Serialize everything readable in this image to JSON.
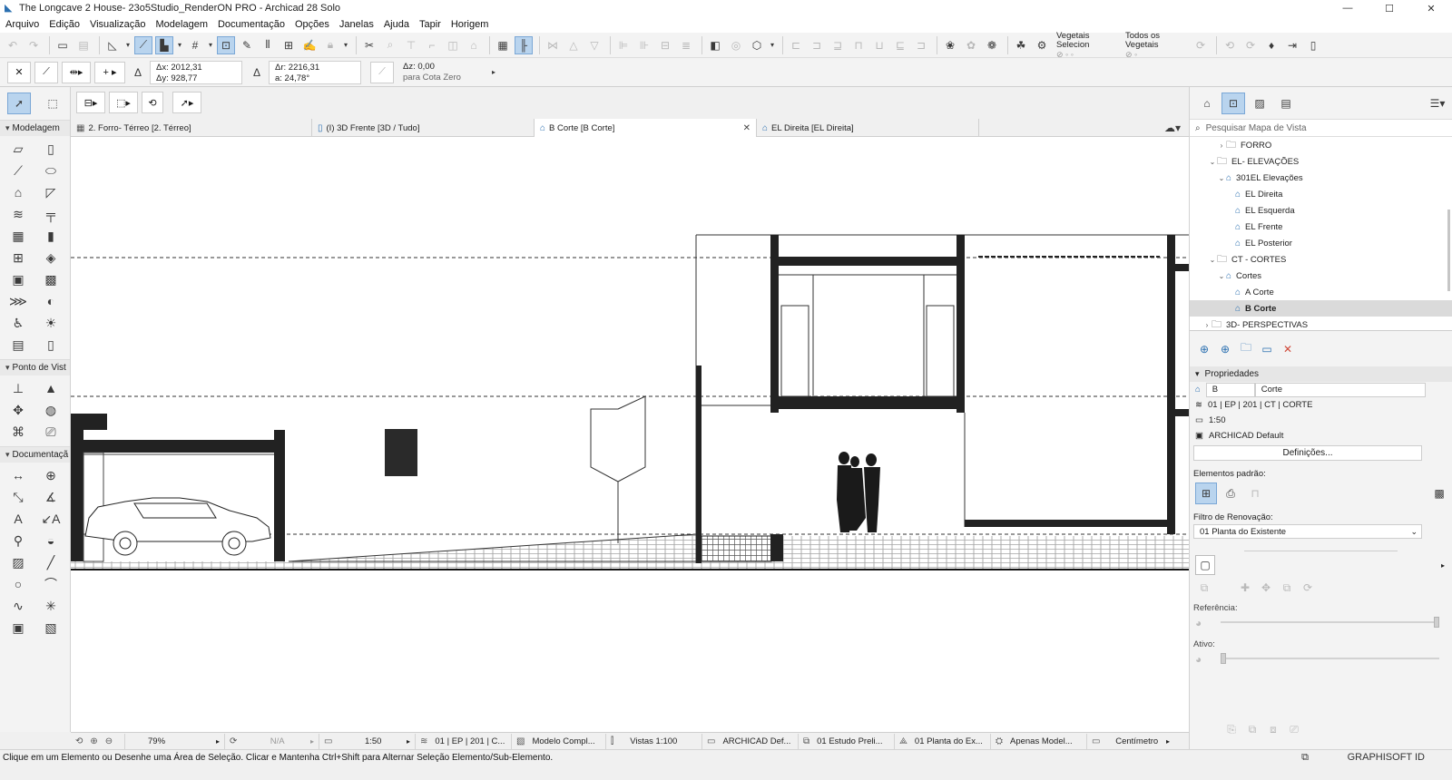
{
  "window": {
    "title": "The Longcave 2 House- 23o5Studio_RenderON PRO - Archicad 28 Solo"
  },
  "menu": [
    "Arquivo",
    "Edição",
    "Visualização",
    "Modelagem",
    "Documentação",
    "Opções",
    "Janelas",
    "Ajuda",
    "Tapir",
    "Horigem"
  ],
  "toolbar": {
    "vegetais_selecion": "Vegetais Selecion",
    "todos_vegetais": "Todos os Vegetais"
  },
  "infobox": {
    "dx": "Δx: 2012,31",
    "dy": "Δy: 928,77",
    "dr": "Δr: 2216,31",
    "angle": "a: 24,78°",
    "dz": "Δz: 0,00",
    "ref": "para Cota Zero"
  },
  "toolbox": {
    "sections": [
      "Modelagem",
      "Ponto de Vist",
      "Documentaçã"
    ]
  },
  "tabs": [
    {
      "label": "2. Forro- Térreo [2. Térreo]"
    },
    {
      "label": "(I) 3D Frente [3D / Tudo]"
    },
    {
      "label": "B Corte [B Corte]"
    },
    {
      "label": "EL Direita [EL Direita]"
    }
  ],
  "status": {
    "zoom": "79%",
    "na": "N/A",
    "scale": "1:50",
    "layer": "01 | EP | 201 | C...",
    "model": "Modelo Compl...",
    "views": "Vistas 1:100",
    "pen": "ARCHICAD Def...",
    "phase": "01 Estudo Preli...",
    "reno": "01 Planta do Ex...",
    "only": "Apenas Model...",
    "unit": "Centímetro"
  },
  "hint": "Clique em um Elemento ou Desenhe uma Área de Seleção. Clicar e Mantenha Ctrl+Shift para Alternar Seleção Elemento/Sub-Elemento.",
  "brand": "GRAPHISOFT ID",
  "navigator": {
    "search_placeholder": "Pesquisar Mapa de Vista",
    "tree": [
      {
        "label": "FORRO",
        "level": 2,
        "kind": "folder",
        "chevron": ">"
      },
      {
        "label": "EL- ELEVAÇÕES",
        "level": 1,
        "kind": "folder",
        "chevron": "v"
      },
      {
        "label": "301EL Elevações",
        "level": 2,
        "kind": "views",
        "chevron": "v"
      },
      {
        "label": "EL Direita",
        "level": 3,
        "kind": "view"
      },
      {
        "label": "EL Esquerda",
        "level": 3,
        "kind": "view"
      },
      {
        "label": "EL Frente",
        "level": 3,
        "kind": "view"
      },
      {
        "label": "EL Posterior",
        "level": 3,
        "kind": "view"
      },
      {
        "label": "CT - CORTES",
        "level": 1,
        "kind": "folder",
        "chevron": "v"
      },
      {
        "label": "Cortes",
        "level": 2,
        "kind": "views",
        "chevron": "v"
      },
      {
        "label": "A Corte",
        "level": 3,
        "kind": "view"
      },
      {
        "label": "B Corte",
        "level": 3,
        "kind": "view",
        "selected": true
      },
      {
        "label": "3D- PERSPECTIVAS",
        "level": 1,
        "kind": "folder",
        "chevron": ">"
      }
    ]
  },
  "properties": {
    "title": "Propriedades",
    "id": "B",
    "name": "Corte",
    "layer": "01 | EP | 201 | CT | CORTE",
    "scale": "1:50",
    "pen": "ARCHICAD Default",
    "settings_button": "Definições...",
    "default_elements": "Elementos padrão:",
    "renovation_label": "Filtro de Renovação:",
    "renovation_value": "01 Planta do Existente",
    "reference": "Referência:",
    "active": "Ativo:"
  },
  "colors": {
    "accent": "#2a6fb0",
    "selection": "#b9d4ee"
  }
}
